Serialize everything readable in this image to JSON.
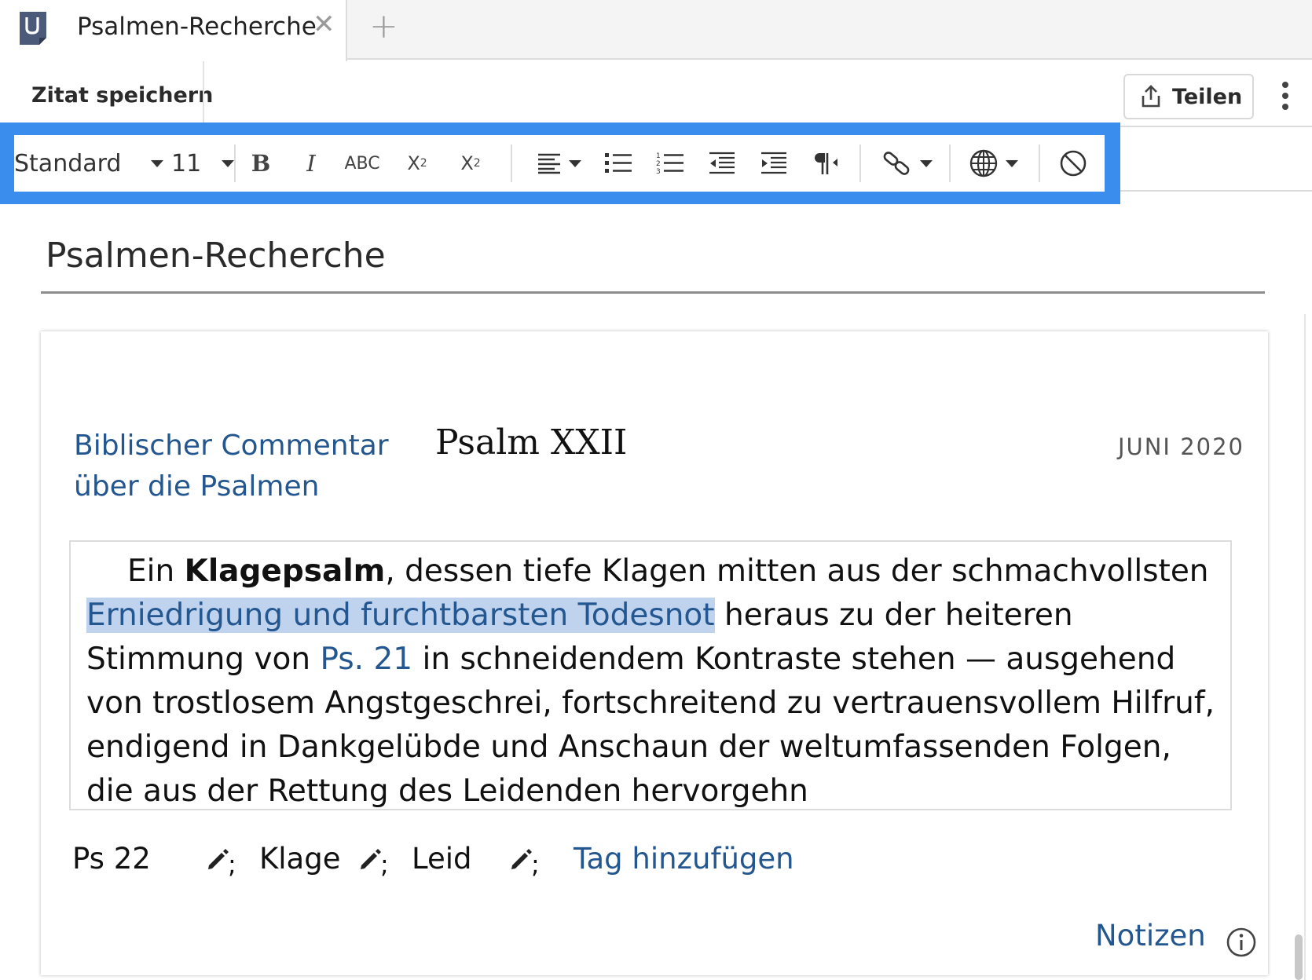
{
  "tabbar": {
    "app_icon": "document-u-icon",
    "active_tab_title": "Psalmen-Recherche",
    "close_icon": "close-icon",
    "add_icon": "plus-icon",
    "close_glyph": "✕",
    "add_glyph": "+"
  },
  "header": {
    "save_label": "Zitat speichern",
    "share_label": "Teilen",
    "share_icon": "share-icon",
    "more_icon": "more-vertical-icon"
  },
  "toolbar": {
    "style_value": "Standard",
    "size_value": "11",
    "bold_label": "B",
    "italic_label": "I",
    "strike_label": "ABC",
    "sup_label": "X",
    "sup_mark": "2",
    "sub_label": "X",
    "sub_mark": "2",
    "highlight_color": "#3b8ded"
  },
  "document": {
    "title": "Psalmen-Recherche",
    "source_line1": "Biblischer Commentar",
    "source_line2": "über die Psalmen",
    "passage_title": "Psalm XXII",
    "date": "JUNI 2020",
    "quote": {
      "part1": "Ein ",
      "bold": "Klagepsalm",
      "part2": ", dessen tiefe Klagen mitten aus der schmachvollsten ",
      "highlight": "Erniedrigung und furchtbarsten Todesnot",
      "part3": " heraus zu der heiteren Stimmung von ",
      "ref": "Ps. 21",
      "part4": " in schneidendem Kontraste stehen — ausgehend von trostlosem Angstgeschrei, fortschreitend zu vertrauensvollem Hilfruf, endigend in Dankgelübde und Anschaun der weltumfassenden Folgen, die aus der Rettung des Leidenden hervorgehn"
    },
    "tags": [
      "Ps 22",
      "Klage",
      "Leid"
    ],
    "tag_separator": ";",
    "add_tag_label": "Tag hinzufügen",
    "notes_label": "Notizen",
    "accent_color": "#24578f"
  }
}
